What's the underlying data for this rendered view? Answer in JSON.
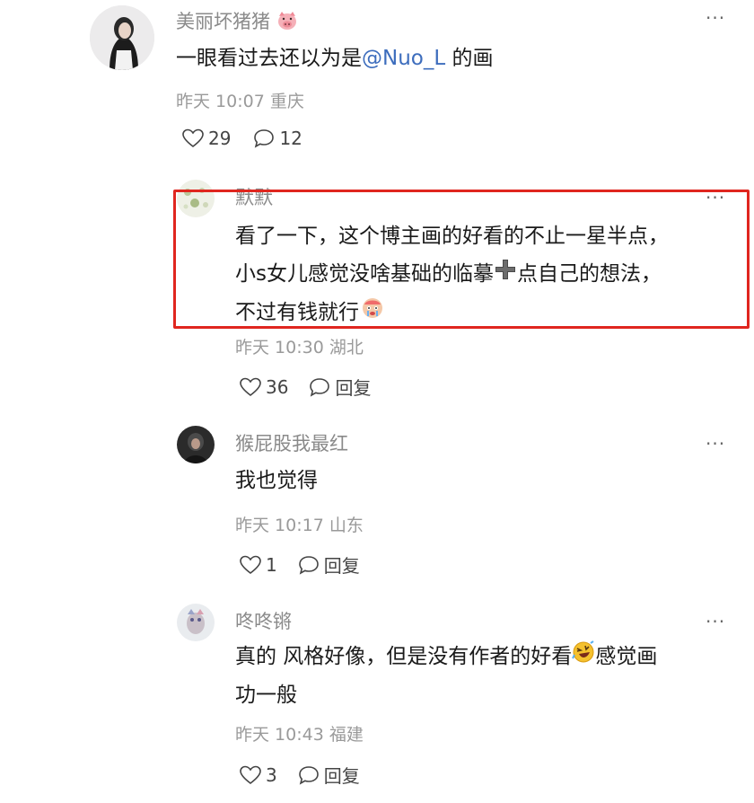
{
  "comments": [
    {
      "username": "美丽坏猪猪",
      "emoji": "pig-face-icon",
      "text_prefix": "一眼看过去还以为是",
      "mention": "@Nuo_L",
      "text_suffix": " 的画",
      "time": "昨天 10:07 重庆",
      "likes": "29",
      "replies": "12"
    },
    {
      "username": "默默",
      "lines": [
        "看了一下，这个博主画的好看的不止一星半点，",
        "小s女儿感觉没啥基础的临摹",
        "点自己的想法，",
        "不过有钱就行"
      ],
      "time": "昨天 10:30 湖北",
      "likes": "36",
      "reply_label": "回复"
    },
    {
      "username": "猴屁股我最红",
      "text": "我也觉得",
      "time": "昨天 10:17 山东",
      "likes": "1",
      "reply_label": "回复"
    },
    {
      "username": "咚咚锵",
      "lines": [
        "真的 风格好像，但是没有作者的好看",
        "感觉画",
        "功一般"
      ],
      "time": "昨天 10:43 福建",
      "likes": "3",
      "reply_label": "回复"
    }
  ],
  "more_label": "···",
  "highlight_color": "#e0261f",
  "mention_color": "#3d6dbd"
}
